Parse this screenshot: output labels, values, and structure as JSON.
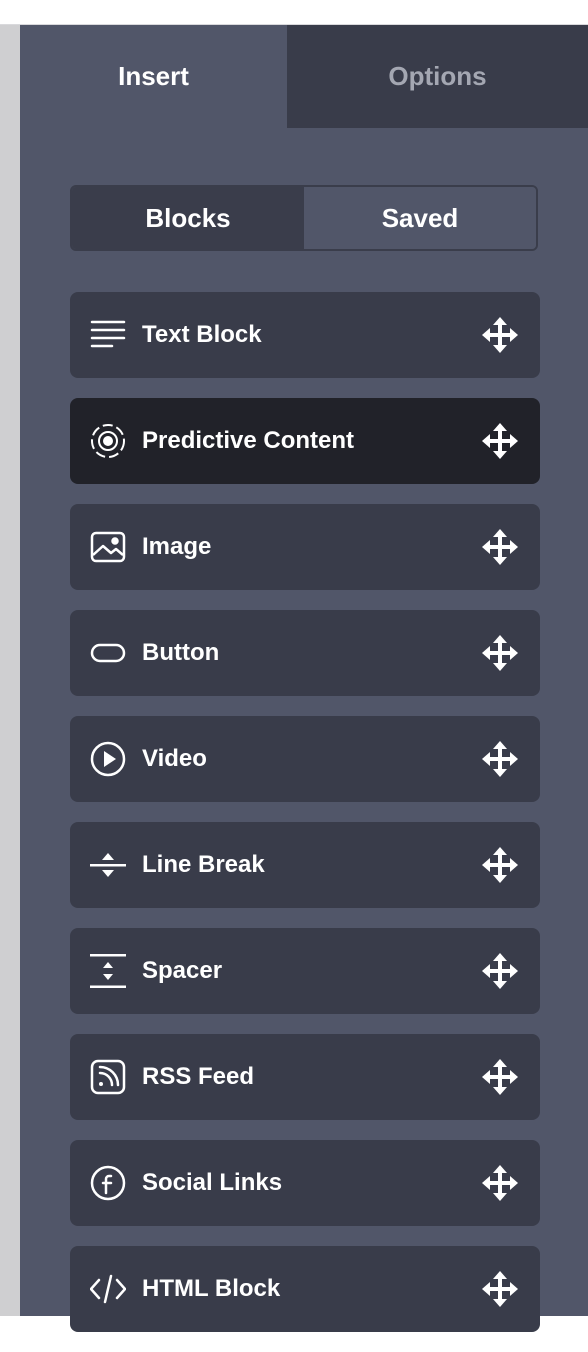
{
  "tabs": {
    "insert_label": "Insert",
    "options_label": "Options"
  },
  "segmented": {
    "blocks_label": "Blocks",
    "saved_label": "Saved"
  },
  "blocks": [
    {
      "label": "Text Block",
      "icon": "text-lines-icon"
    },
    {
      "label": "Predictive Content",
      "icon": "predictive-target-icon",
      "active": true
    },
    {
      "label": "Image",
      "icon": "image-icon"
    },
    {
      "label": "Button",
      "icon": "button-pill-icon"
    },
    {
      "label": "Video",
      "icon": "play-circle-icon"
    },
    {
      "label": "Line Break",
      "icon": "line-break-icon"
    },
    {
      "label": "Spacer",
      "icon": "spacer-icon"
    },
    {
      "label": "RSS Feed",
      "icon": "rss-icon"
    },
    {
      "label": "Social Links",
      "icon": "facebook-circle-icon"
    },
    {
      "label": "HTML Block",
      "icon": "code-icon"
    }
  ],
  "colors": {
    "panel": "#515669",
    "tab_inactive": "#393c4a",
    "item": "#393c4a",
    "item_active": "#212229",
    "text": "#ffffff",
    "muted_text": "#a4a7b2"
  }
}
